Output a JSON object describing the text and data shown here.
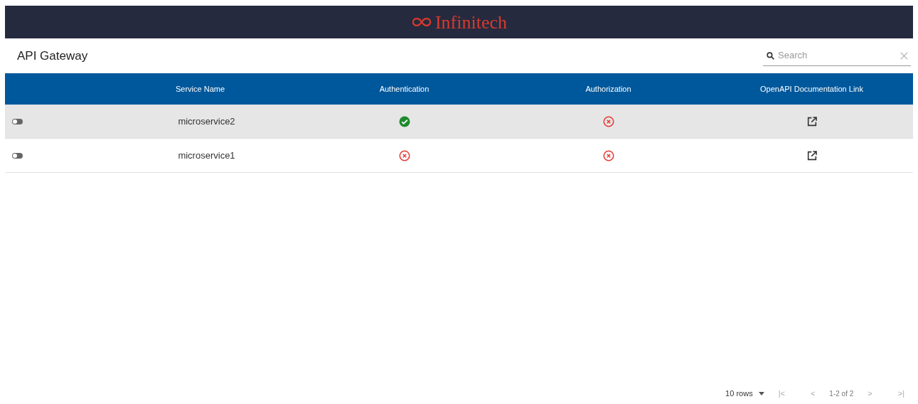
{
  "header": {
    "logo_text": "Infinitech"
  },
  "toolbar": {
    "title": "API Gateway",
    "search": {
      "placeholder": "Search"
    }
  },
  "table": {
    "columns": [
      "",
      "Service Name",
      "Authentication",
      "Authorization",
      "OpenAPI Documentation Link"
    ],
    "rows": [
      {
        "selected": true,
        "enabled": false,
        "service_name": "microservice2",
        "authentication": true,
        "authorization": false
      },
      {
        "selected": false,
        "enabled": false,
        "service_name": "microservice1",
        "authentication": false,
        "authorization": false
      }
    ]
  },
  "pagination": {
    "rows_per_page": "10 rows",
    "first": "|<",
    "previous": "<",
    "range": "1-2 of 2",
    "next": ">",
    "last": ">|"
  }
}
